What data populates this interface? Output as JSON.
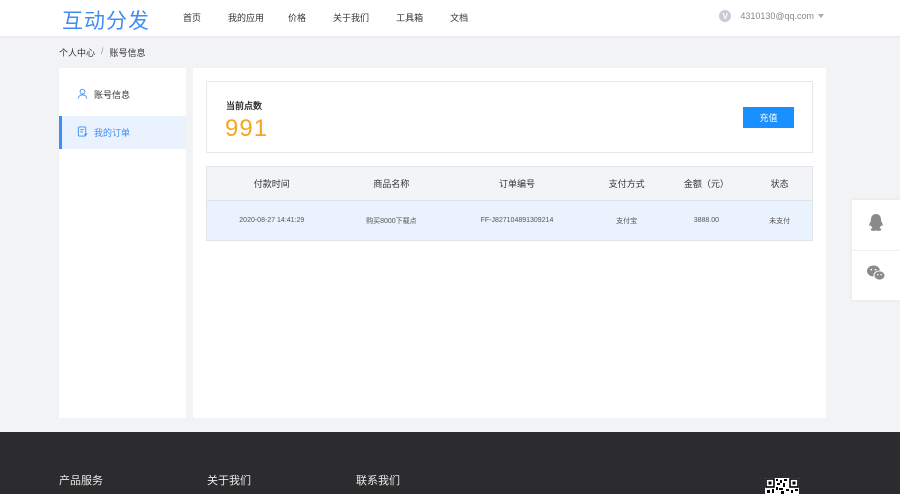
{
  "header": {
    "logo": "互动分发",
    "nav": [
      "首页",
      "我的应用",
      "价格",
      "关于我们",
      "工具箱",
      "文档"
    ],
    "user": {
      "badge": "V",
      "email": "4310130@qq.com"
    }
  },
  "breadcrumb": {
    "root": "个人中心",
    "separator": "/",
    "current": "账号信息"
  },
  "sidebar": {
    "items": [
      {
        "label": "账号信息",
        "icon": "user-icon",
        "active": false
      },
      {
        "label": "我的订单",
        "icon": "order-icon",
        "active": true
      }
    ]
  },
  "points": {
    "label": "当前点数",
    "value": "991",
    "recharge_label": "充值"
  },
  "orders": {
    "columns": [
      "付款时间",
      "商品名称",
      "订单编号",
      "支付方式",
      "金额（元）",
      "状态"
    ],
    "rows": [
      [
        "2020-08-27 14:41:29",
        "购买8000下载点",
        "FF-J827104891309214",
        "支付宝",
        "3888.00",
        "未支付"
      ]
    ]
  },
  "float_bar": {
    "items": [
      "qq-icon",
      "wechat-icon"
    ]
  },
  "footer": {
    "columns": [
      "产品服务",
      "关于我们",
      "联系我们"
    ]
  },
  "colors": {
    "accent": "#3f8ef7",
    "points": "#f5a623",
    "button": "#1890ff",
    "footer": "#2c2c2e"
  }
}
